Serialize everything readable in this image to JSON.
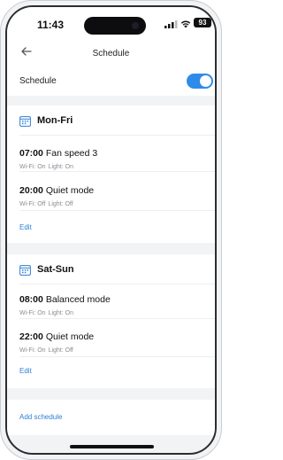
{
  "status_bar": {
    "time": "11:43",
    "battery": "93",
    "icons": [
      "signal-icon",
      "wifi-icon",
      "battery-icon"
    ]
  },
  "nav": {
    "back_icon": "back-arrow-icon",
    "title": "Schedule"
  },
  "schedule_toggle": {
    "label": "Schedule",
    "enabled": true
  },
  "groups": [
    {
      "days": "Mon-Fri",
      "entries": [
        {
          "time": "07:00",
          "mode": "Fan speed 3",
          "wifi": "Wi-Fi: On",
          "light": "Light: On"
        },
        {
          "time": "20:00",
          "mode": "Quiet mode",
          "wifi": "Wi-Fi: Off",
          "light": "Light: Off"
        }
      ],
      "edit_label": "Edit"
    },
    {
      "days": "Sat-Sun",
      "entries": [
        {
          "time": "08:00",
          "mode": "Balanced mode",
          "wifi": "Wi-Fi: On",
          "light": "Light: On"
        },
        {
          "time": "22:00",
          "mode": "Quiet mode",
          "wifi": "Wi-Fi: On",
          "light": "Light: Off"
        }
      ],
      "edit_label": "Edit"
    }
  ],
  "add_schedule_label": "Add schedule",
  "colors": {
    "accent": "#2e8bea",
    "link": "#2e7fd6",
    "background": "#f2f3f5"
  }
}
